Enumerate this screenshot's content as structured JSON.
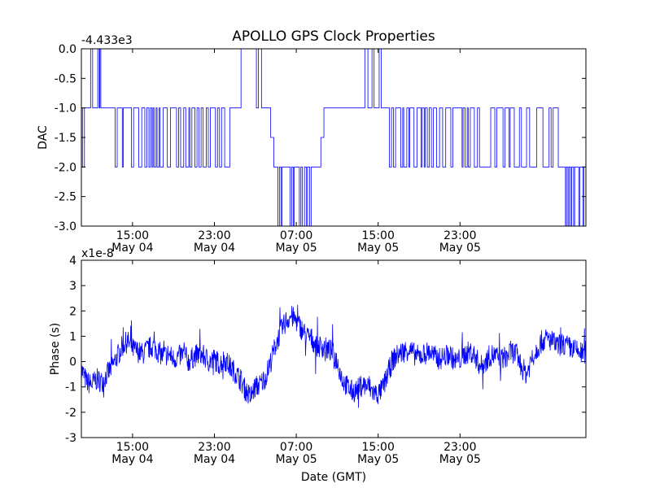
{
  "figure": {
    "title": "APOLLO GPS Clock Properties",
    "xlabel": "Date (GMT)"
  },
  "chart_data": [
    {
      "type": "line",
      "title": "APOLLO GPS Clock Properties",
      "ylabel": "DAC",
      "offset_label": "-4.433e3",
      "color": "#0000ff",
      "ylim": [
        -3.0,
        0.0
      ],
      "xlim_hours": [
        0,
        0
      ],
      "x_ticks": [
        {
          "time": "15:00",
          "date": "May 04"
        },
        {
          "time": "23:00",
          "date": "May 04"
        },
        {
          "time": "07:00",
          "date": "May 05"
        },
        {
          "time": "15:00",
          "date": "May 05"
        },
        {
          "time": "23:00",
          "date": "May 05"
        }
      ],
      "y_ticks": [
        "0.0",
        "-0.5",
        "-1.0",
        "-1.5",
        "-2.0",
        "-2.5",
        "-3.0"
      ],
      "series": [
        {
          "x_start": "May 04 10:00",
          "x_end": "May 06 00:00",
          "levels": [
            [
              0.0,
              -1
            ],
            [
              0.1,
              -2
            ],
            [
              0.3,
              -1
            ],
            [
              0.9,
              0
            ],
            [
              1.1,
              -1
            ],
            [
              1.6,
              0
            ],
            [
              1.75,
              -1
            ],
            [
              1.8,
              0
            ],
            [
              1.9,
              -1
            ],
            [
              3.3,
              -2
            ],
            [
              3.5,
              -1
            ],
            [
              4.0,
              -2
            ],
            [
              4.1,
              -1
            ],
            [
              4.9,
              -2
            ],
            [
              5.1,
              -1
            ],
            [
              5.6,
              -2
            ],
            [
              5.9,
              -1
            ],
            [
              6.2,
              -2
            ],
            [
              6.4,
              -1
            ],
            [
              6.6,
              -2
            ],
            [
              6.75,
              -1
            ],
            [
              6.9,
              -2
            ],
            [
              7.0,
              -1
            ],
            [
              7.1,
              -2
            ],
            [
              7.3,
              -1
            ],
            [
              7.4,
              -2
            ],
            [
              7.6,
              -1
            ],
            [
              7.7,
              -2
            ],
            [
              8.0,
              -1
            ],
            [
              8.4,
              -2
            ],
            [
              8.7,
              -1
            ],
            [
              9.3,
              -2
            ],
            [
              9.5,
              -1
            ],
            [
              9.7,
              -2
            ],
            [
              10.0,
              -1
            ],
            [
              10.2,
              -2
            ],
            [
              10.5,
              -1
            ],
            [
              10.6,
              -2
            ],
            [
              10.8,
              -1
            ],
            [
              11.1,
              -2
            ],
            [
              11.3,
              -1
            ],
            [
              11.5,
              -2
            ],
            [
              11.7,
              -1
            ],
            [
              11.9,
              -2
            ],
            [
              12.2,
              -1
            ],
            [
              12.4,
              -2
            ],
            [
              12.6,
              -1
            ],
            [
              13.1,
              -2
            ],
            [
              13.3,
              -1
            ],
            [
              13.5,
              -2
            ],
            [
              13.7,
              -1
            ],
            [
              14.0,
              -2
            ],
            [
              14.5,
              -1
            ],
            [
              15.6,
              0
            ],
            [
              17.1,
              -1
            ],
            [
              17.3,
              0
            ],
            [
              17.6,
              -1
            ],
            [
              18.5,
              -1.5
            ],
            [
              18.8,
              -2
            ],
            [
              19.2,
              -3
            ],
            [
              19.35,
              -2
            ],
            [
              19.5,
              -3
            ],
            [
              19.6,
              -2
            ],
            [
              20.4,
              -3
            ],
            [
              20.55,
              -2
            ],
            [
              20.7,
              -3
            ],
            [
              20.8,
              -2
            ],
            [
              21.1,
              -2
            ],
            [
              21.3,
              -3
            ],
            [
              21.45,
              -2
            ],
            [
              21.6,
              -3
            ],
            [
              21.8,
              -2
            ],
            [
              22.0,
              -3
            ],
            [
              22.1,
              -2
            ],
            [
              22.3,
              -3
            ],
            [
              22.45,
              -2
            ],
            [
              22.6,
              -2
            ],
            [
              23.3,
              -2
            ],
            [
              23.4,
              -1.5
            ],
            [
              23.7,
              -1
            ],
            [
              27.7,
              0
            ],
            [
              28.0,
              -1
            ],
            [
              28.4,
              0
            ],
            [
              28.6,
              -1
            ],
            [
              29.1,
              0
            ],
            [
              29.3,
              -1
            ],
            [
              30.1,
              -2
            ],
            [
              30.3,
              -1
            ],
            [
              30.5,
              -2
            ],
            [
              30.7,
              -1
            ],
            [
              31.2,
              -2
            ],
            [
              31.4,
              -1
            ],
            [
              31.5,
              -2
            ],
            [
              31.8,
              -1
            ],
            [
              32.0,
              -2
            ],
            [
              32.1,
              -1
            ],
            [
              32.5,
              -2
            ],
            [
              32.8,
              -1
            ],
            [
              33.2,
              -2
            ],
            [
              33.3,
              -1
            ],
            [
              33.5,
              -2
            ],
            [
              33.6,
              -1
            ],
            [
              33.8,
              -2
            ],
            [
              34.0,
              -1
            ],
            [
              34.2,
              -2
            ],
            [
              34.4,
              -1
            ],
            [
              34.7,
              -2
            ],
            [
              35.0,
              -1
            ],
            [
              35.3,
              -2
            ],
            [
              35.6,
              -1
            ],
            [
              36.1,
              -2
            ],
            [
              36.3,
              -1
            ],
            [
              37.2,
              -2
            ],
            [
              37.3,
              -1
            ],
            [
              37.5,
              -2
            ],
            [
              37.7,
              -1
            ],
            [
              37.8,
              -2
            ],
            [
              38.0,
              -1
            ],
            [
              38.4,
              -2
            ],
            [
              38.7,
              -1
            ],
            [
              38.9,
              -2
            ],
            [
              40.0,
              -1
            ],
            [
              40.4,
              -2
            ],
            [
              40.6,
              -1
            ],
            [
              41.2,
              -2
            ],
            [
              41.4,
              -1
            ],
            [
              41.8,
              -2
            ],
            [
              41.9,
              -1
            ],
            [
              42.3,
              -2
            ],
            [
              42.6,
              -2
            ],
            [
              42.8,
              -1
            ],
            [
              43.0,
              -2
            ],
            [
              43.1,
              -2
            ],
            [
              43.5,
              -1
            ],
            [
              43.8,
              -2
            ],
            [
              44.0,
              -2
            ],
            [
              44.5,
              -1
            ],
            [
              45.1,
              -2
            ],
            [
              45.7,
              -1
            ],
            [
              45.9,
              -2
            ],
            [
              46.1,
              -1
            ],
            [
              46.6,
              -2
            ],
            [
              47.2,
              -2
            ],
            [
              47.3,
              -3
            ],
            [
              47.4,
              -2
            ],
            [
              47.55,
              -3
            ],
            [
              47.65,
              -2
            ],
            [
              47.8,
              -3
            ],
            [
              47.9,
              -2
            ],
            [
              48.1,
              -3
            ],
            [
              48.2,
              -2
            ],
            [
              48.4,
              -2
            ],
            [
              48.6,
              -3
            ],
            [
              48.7,
              -2
            ],
            [
              48.8,
              -2
            ],
            [
              49.0,
              -3
            ],
            [
              49.1,
              -2
            ],
            [
              49.3,
              -2
            ]
          ]
        }
      ]
    },
    {
      "type": "line",
      "ylabel": "Phase (s)",
      "offset_label": "x1e-8",
      "xlabel": "Date (GMT)",
      "color": "#0000ff",
      "ylim": [
        -3,
        4
      ],
      "x_ticks": [
        {
          "time": "15:00",
          "date": "May 04"
        },
        {
          "time": "23:00",
          "date": "May 04"
        },
        {
          "time": "07:00",
          "date": "May 05"
        },
        {
          "time": "15:00",
          "date": "May 05"
        },
        {
          "time": "23:00",
          "date": "May 05"
        }
      ],
      "y_ticks": [
        "4",
        "3",
        "2",
        "1",
        "0",
        "-1",
        "-2",
        "-3"
      ],
      "series": [
        {
          "x_start": "May 04 10:00",
          "x_end": "May 06 00:00",
          "trend": [
            [
              0.0,
              -0.3
            ],
            [
              0.5,
              -0.8
            ],
            [
              1.0,
              -0.9
            ],
            [
              1.5,
              -0.7
            ],
            [
              2.0,
              -0.8
            ],
            [
              2.5,
              -0.5
            ],
            [
              3.0,
              -0.2
            ],
            [
              3.5,
              0.2
            ],
            [
              4.0,
              0.6
            ],
            [
              4.5,
              0.8
            ],
            [
              5.0,
              0.5
            ],
            [
              5.5,
              0.4
            ],
            [
              6.0,
              0.3
            ],
            [
              6.5,
              0.5
            ],
            [
              7.0,
              0.6
            ],
            [
              7.5,
              0.4
            ],
            [
              8.0,
              0.2
            ],
            [
              8.5,
              0.3
            ],
            [
              9.0,
              0.1
            ],
            [
              9.5,
              0.2
            ],
            [
              10.0,
              0.3
            ],
            [
              10.5,
              0.0
            ],
            [
              11.0,
              0.2
            ],
            [
              11.5,
              0.3
            ],
            [
              12.0,
              0.2
            ],
            [
              12.5,
              0.0
            ],
            [
              13.0,
              0.1
            ],
            [
              13.5,
              -0.1
            ],
            [
              14.0,
              0.1
            ],
            [
              14.5,
              -0.2
            ],
            [
              15.0,
              -0.4
            ],
            [
              15.5,
              -0.7
            ],
            [
              16.0,
              -1.1
            ],
            [
              16.5,
              -1.4
            ],
            [
              17.0,
              -1.0
            ],
            [
              17.5,
              -0.9
            ],
            [
              18.0,
              -0.6
            ],
            [
              18.5,
              0.0
            ],
            [
              19.0,
              0.7
            ],
            [
              19.5,
              1.2
            ],
            [
              20.0,
              1.6
            ],
            [
              20.5,
              1.8
            ],
            [
              21.0,
              1.6
            ],
            [
              21.5,
              1.3
            ],
            [
              22.0,
              1.0
            ],
            [
              22.5,
              0.9
            ],
            [
              23.0,
              0.6
            ],
            [
              23.5,
              0.6
            ],
            [
              24.0,
              0.5
            ],
            [
              24.5,
              0.4
            ],
            [
              25.0,
              0.0
            ],
            [
              25.5,
              -0.7
            ],
            [
              26.0,
              -1.0
            ],
            [
              26.5,
              -1.2
            ],
            [
              27.0,
              -1.1
            ],
            [
              27.5,
              -0.9
            ],
            [
              28.0,
              -1.0
            ],
            [
              28.5,
              -1.2
            ],
            [
              29.0,
              -1.3
            ],
            [
              29.5,
              -1.0
            ],
            [
              30.0,
              -0.4
            ],
            [
              30.5,
              0.1
            ],
            [
              31.0,
              0.3
            ],
            [
              31.5,
              0.4
            ],
            [
              32.0,
              0.5
            ],
            [
              32.5,
              0.3
            ],
            [
              33.0,
              0.2
            ],
            [
              33.5,
              0.3
            ],
            [
              34.0,
              0.4
            ],
            [
              34.5,
              0.2
            ],
            [
              35.0,
              0.1
            ],
            [
              35.5,
              0.2
            ],
            [
              36.0,
              0.3
            ],
            [
              36.5,
              0.0
            ],
            [
              37.0,
              0.1
            ],
            [
              37.5,
              0.3
            ],
            [
              38.0,
              0.4
            ],
            [
              38.5,
              0.2
            ],
            [
              39.0,
              -0.2
            ],
            [
              39.5,
              0.0
            ],
            [
              40.0,
              0.3
            ],
            [
              40.5,
              0.2
            ],
            [
              41.0,
              0.1
            ],
            [
              41.5,
              0.2
            ],
            [
              42.0,
              0.4
            ],
            [
              42.5,
              0.3
            ],
            [
              43.0,
              -0.2
            ],
            [
              43.5,
              -0.5
            ],
            [
              44.0,
              0.1
            ],
            [
              44.5,
              0.5
            ],
            [
              45.0,
              0.8
            ],
            [
              45.5,
              0.9
            ],
            [
              46.0,
              0.8
            ],
            [
              46.5,
              0.6
            ],
            [
              47.0,
              0.7
            ],
            [
              47.5,
              0.6
            ],
            [
              48.0,
              0.5
            ],
            [
              48.5,
              0.4
            ],
            [
              49.0,
              0.3
            ],
            [
              49.3,
              0.4
            ]
          ],
          "noise_amplitude": 0.45
        }
      ]
    }
  ]
}
